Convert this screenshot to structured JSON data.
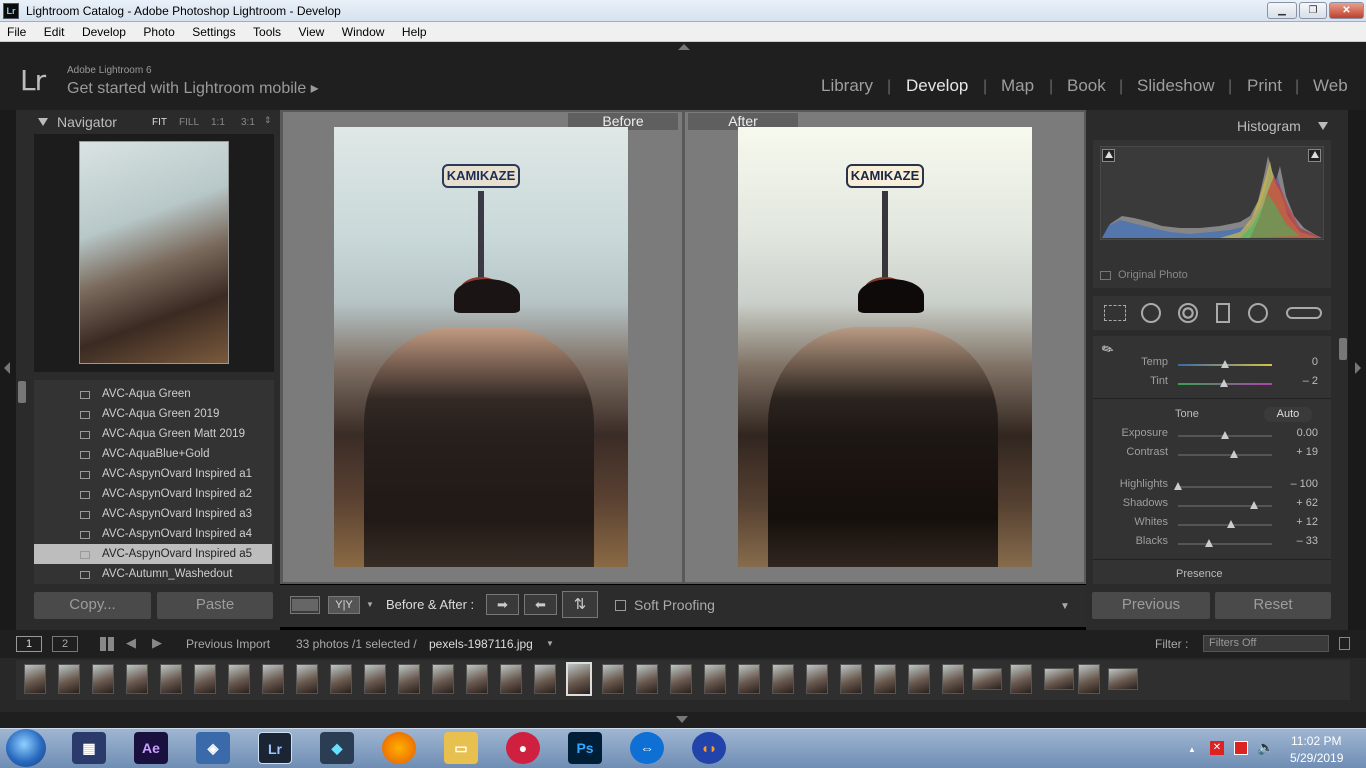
{
  "window": {
    "title": "Lightroom Catalog - Adobe Photoshop Lightroom - Develop",
    "icon": "Lr",
    "controls": [
      "minimize",
      "maximize",
      "close"
    ]
  },
  "menu": [
    "File",
    "Edit",
    "Develop",
    "Photo",
    "Settings",
    "Tools",
    "View",
    "Window",
    "Help"
  ],
  "identity": {
    "logo": "Lr",
    "version": "Adobe Lightroom 6",
    "mobile": "Get started with Lightroom mobile ▸"
  },
  "modules": [
    "Library",
    "Develop",
    "Map",
    "Book",
    "Slideshow",
    "Print",
    "Web"
  ],
  "active_module": "Develop",
  "navigator": {
    "title": "Navigator",
    "zoom_options": [
      "FIT",
      "FILL",
      "1:1",
      "3:1"
    ]
  },
  "presets": [
    "AVC-Aqua Green",
    "AVC-Aqua Green 2019",
    "AVC-Aqua Green Matt 2019",
    "AVC-AquaBlue+Gold",
    "AVC-AspynOvard Inspired a1",
    "AVC-AspynOvard Inspired a2",
    "AVC-AspynOvard Inspired a3",
    "AVC-AspynOvard Inspired a4",
    "AVC-AspynOvard Inspired a5",
    "AVC-Autumn_Washedout"
  ],
  "selected_preset_index": 8,
  "left_buttons": {
    "copy": "Copy...",
    "paste": "Paste"
  },
  "compare": {
    "before": "Before",
    "after": "After"
  },
  "photo_text": "KAMIKAZE",
  "toolbar": {
    "mode": "Before & After :",
    "yy": "Y|Y",
    "soft_proofing": "Soft Proofing"
  },
  "histogram": {
    "title": "Histogram",
    "original_photo": "Original Photo"
  },
  "wb": {
    "temp": {
      "label": "Temp",
      "value": "0",
      "level": 0.5
    },
    "tint": {
      "label": "Tint",
      "value": "– 2",
      "level": 0.49
    }
  },
  "tone": {
    "label": "Tone",
    "auto": "Auto",
    "sliders": [
      {
        "label": "Exposure",
        "value": "0.00",
        "level": 0.5
      },
      {
        "label": "Contrast",
        "value": "+ 19",
        "level": 0.595
      },
      {
        "label": "Highlights",
        "value": "– 100",
        "level": 0.0
      },
      {
        "label": "Shadows",
        "value": "+ 62",
        "level": 0.81
      },
      {
        "label": "Whites",
        "value": "+ 12",
        "level": 0.56
      },
      {
        "label": "Blacks",
        "value": "– 33",
        "level": 0.335
      }
    ]
  },
  "presence": "Presence",
  "right_buttons": {
    "previous": "Previous",
    "reset": "Reset"
  },
  "filmstrip": {
    "pages": [
      "1",
      "2"
    ],
    "source": "Previous Import",
    "count": "33 photos /1 selected /",
    "filename": "pexels-1987116.jpg",
    "filter_label": "Filter :",
    "filter_value": "Filters Off"
  },
  "tray": {
    "time": "11:02 PM",
    "date": "5/29/2019"
  },
  "colors": {
    "accent": "#e0e0e0",
    "bg": "#1f1f1f",
    "panel": "#333333"
  }
}
